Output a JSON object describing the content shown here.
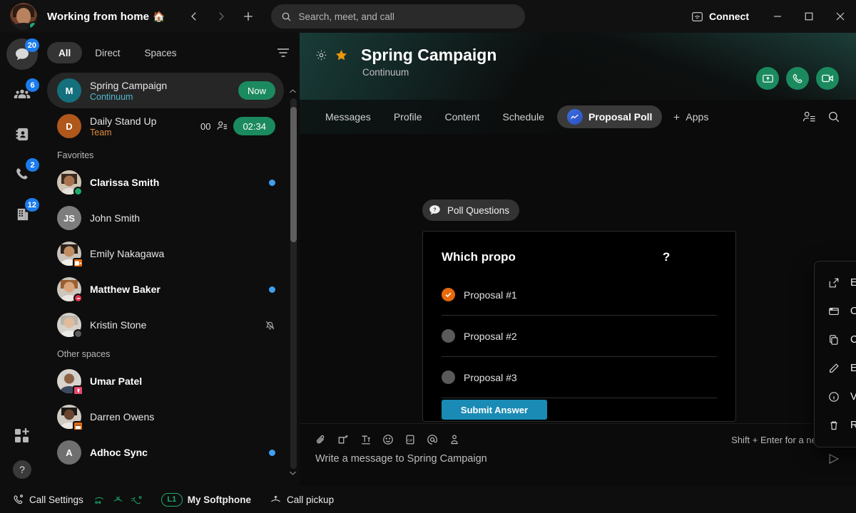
{
  "titlebar": {
    "status_text": "Working from home",
    "status_emoji": "🏠",
    "back_icon": "chevron-left-icon",
    "forward_icon": "chevron-right-icon",
    "new_icon": "plus-icon",
    "connect_label": "Connect",
    "minimize_label": "—",
    "maximize_label": "□",
    "close_label": "✕"
  },
  "search": {
    "placeholder": "Search, meet, and call"
  },
  "rail": {
    "items": [
      {
        "name": "messages",
        "badge": "20"
      },
      {
        "name": "teams",
        "badge": "6"
      },
      {
        "name": "contacts",
        "badge": ""
      },
      {
        "name": "calls",
        "badge": "2"
      },
      {
        "name": "workspaces",
        "badge": "12"
      }
    ]
  },
  "filters": {
    "tabs": [
      "All",
      "Direct",
      "Spaces"
    ],
    "active": "All"
  },
  "conversations": {
    "items": [
      {
        "avatar_text": "M",
        "avatar_color": "#14707d",
        "title": "Spring Campaign",
        "sub": "Continuum",
        "sub_color": "#4fb9cf",
        "pill": "Now",
        "selected": true,
        "bold": false
      },
      {
        "avatar_text": "D",
        "avatar_color": "#b0571c",
        "title": "Daily Stand Up",
        "sub": "Team",
        "sub_color": "#e08a3c",
        "count": "00",
        "pill": "02:34",
        "bold": false
      }
    ],
    "favorites_header": "Favorites",
    "favorites": [
      {
        "title": "Clarissa Smith",
        "bold": true,
        "unread": true,
        "status": "available"
      },
      {
        "title": "John Smith",
        "bold": false,
        "initials": "JS"
      },
      {
        "title": "Emily Nakagawa",
        "bold": false,
        "status": "video"
      },
      {
        "title": "Matthew Baker",
        "bold": true,
        "unread": true,
        "status": "dnd"
      },
      {
        "title": "Kristin Stone",
        "bold": false,
        "status": "dnd-quiet",
        "muted": true
      }
    ],
    "other_header": "Other spaces",
    "other": [
      {
        "title": "Umar Patel",
        "bold": true,
        "status": "ooo"
      },
      {
        "title": "Darren Owens",
        "bold": false,
        "status": "calendar"
      },
      {
        "title": "Adhoc Sync",
        "bold": true,
        "initials": "A",
        "unread": true
      }
    ]
  },
  "space": {
    "gear_icon": "gear-icon",
    "star_icon": "star-icon",
    "title": "Spring Campaign",
    "subtitle": "Continuum",
    "actions": [
      "share-screen-icon",
      "call-icon",
      "video-icon"
    ]
  },
  "tabs": {
    "items": [
      {
        "label": "Messages",
        "active": false
      },
      {
        "label": "Profile",
        "active": false
      },
      {
        "label": "Content",
        "active": false
      },
      {
        "label": "Schedule",
        "active": false
      },
      {
        "label": "Proposal Poll",
        "active": true,
        "icon": "poll-app-icon"
      }
    ],
    "apps_label": "Apps",
    "right_icons": [
      "people-icon",
      "search-icon"
    ]
  },
  "poll": {
    "chip_label": "Poll Questions",
    "question": "Which propo",
    "question_suffix": "?",
    "options": [
      {
        "label": "Proposal #1",
        "selected": true
      },
      {
        "label": "Proposal #2",
        "selected": false
      },
      {
        "label": "Proposal #3",
        "selected": false
      }
    ],
    "submit_label": "Submit Answer"
  },
  "context_menu": {
    "items": [
      {
        "label": "Expand",
        "icon": "expand-icon"
      },
      {
        "label": "Open in browser",
        "icon": "browser-icon"
      },
      {
        "label": "Copy link",
        "icon": "copy-icon"
      },
      {
        "label": "Edit",
        "icon": "pencil-icon"
      },
      {
        "label": "View information",
        "icon": "info-icon"
      },
      {
        "label": "Remove",
        "icon": "trash-icon"
      }
    ]
  },
  "composer": {
    "tools": [
      "attach-icon",
      "screen-share-icon",
      "format-text-icon",
      "emoji-icon",
      "gif-icon",
      "mention-icon",
      "meeting-icon"
    ],
    "hint": "Shift + Enter for a new line",
    "placeholder": "Write a message to Spring Campaign",
    "send_icon": "send-icon"
  },
  "footer": {
    "call_settings": "Call Settings",
    "softphone_badge": "L1",
    "softphone_label": "My Softphone",
    "call_pickup": "Call pickup"
  },
  "colors": {
    "accent_blue": "#1b7ced",
    "green": "#1b8a5f",
    "orange": "#e8690b",
    "submit_blue": "#1a8bb5"
  }
}
